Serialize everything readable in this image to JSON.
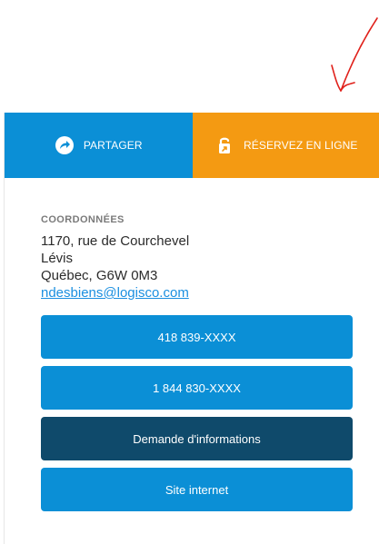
{
  "share": {
    "label": "PARTAGER",
    "icon": "share-arrow-icon"
  },
  "reserve": {
    "label": "RÉSERVEZ EN LIGNE",
    "icon": "unlocked-padlock-icon"
  },
  "contact": {
    "title": "COORDONNÉES",
    "address": [
      "1170, rue de Courchevel",
      "Lévis",
      "Québec, G6W 0M3"
    ],
    "email": "ndesbiens@logisco.com"
  },
  "buttons": {
    "phone1": "418 839-XXXX",
    "phone2": "1 844 830-XXXX",
    "info": "Demande d'informations",
    "website": "Site internet"
  },
  "colors": {
    "share_bg": "#0b8fd6",
    "reserve_bg": "#f49a12",
    "button_blue": "#0b8fd6",
    "button_dark": "#0f4a6b",
    "link": "#1a8fe0",
    "annotation": "#e0201a"
  }
}
